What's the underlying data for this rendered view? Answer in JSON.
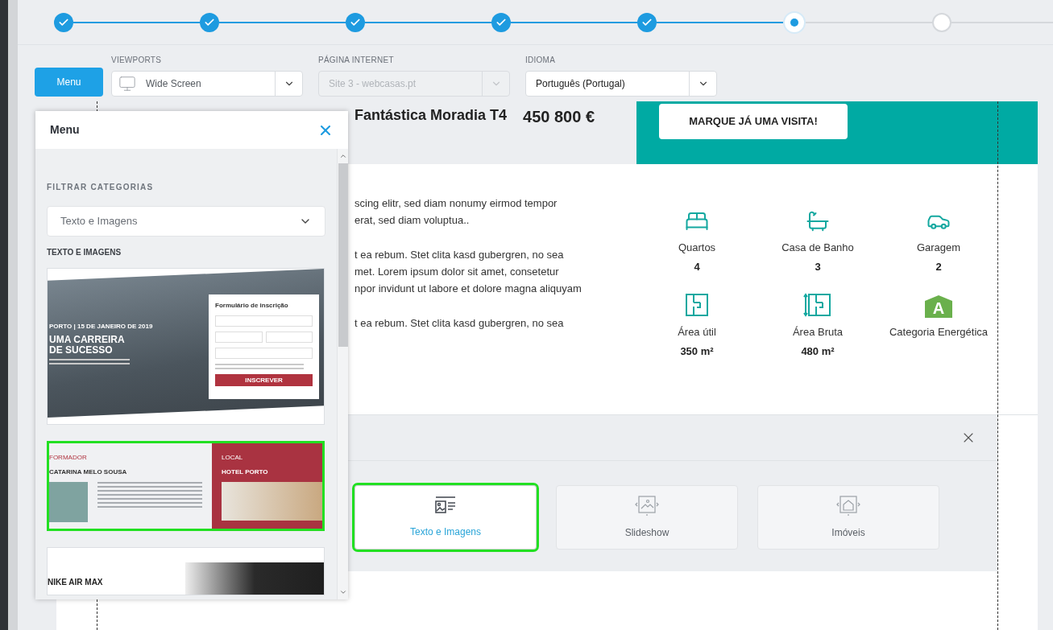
{
  "stepper": [
    {
      "done": true,
      "current": false
    },
    {
      "done": true,
      "current": false
    },
    {
      "done": true,
      "current": false
    },
    {
      "done": true,
      "current": false
    },
    {
      "done": true,
      "current": false
    },
    {
      "done": false,
      "current": true
    },
    {
      "done": false,
      "current": false
    }
  ],
  "toolbar": {
    "menu_button": "Menu",
    "fields": [
      {
        "label": "VIEWPORTS",
        "value": "Wide Screen",
        "kind": "device",
        "disabled": false
      },
      {
        "label": "PÁGINA INTERNET",
        "value": "Site 3 - webcasas.pt",
        "kind": "plain",
        "disabled": true
      },
      {
        "label": "IDIOMA",
        "value": "Português (Portugal)",
        "kind": "plain",
        "disabled": false
      }
    ]
  },
  "page": {
    "title": "Fantástica Moradia T4",
    "price": "450 800 €",
    "cta": "MARQUE JÁ UMA VISITA!",
    "paragraphs": [
      [
        "scing elitr, sed diam nonumy eirmod tempor",
        "erat, sed diam voluptua.."
      ],
      [
        "t ea rebum. Stet clita kasd gubergren, no sea",
        "met. Lorem ipsum dolor sit amet, consetetur",
        "npor invidunt ut labore et dolore magna aliquyam"
      ],
      [
        "t ea rebum. Stet clita kasd gubergren, no sea"
      ]
    ],
    "features": [
      {
        "kind": "bed",
        "label": "Quartos",
        "value": "4"
      },
      {
        "kind": "bath",
        "label": "Casa de Banho",
        "value": "3"
      },
      {
        "kind": "car",
        "label": "Garagem",
        "value": "2"
      },
      {
        "kind": "area",
        "label": "Área útil",
        "value": "350 m²"
      },
      {
        "kind": "gross",
        "label": "Área Bruta",
        "value": "480 m²"
      },
      {
        "kind": "energy",
        "label": "Categoria Energética",
        "grade": "A"
      }
    ]
  },
  "block_picker": {
    "types": [
      {
        "kind": "text",
        "label": "Texto e Imagens",
        "selected": true,
        "highlighted": true
      },
      {
        "kind": "slides",
        "label": "Slideshow",
        "selected": false,
        "highlighted": false
      },
      {
        "kind": "home",
        "label": "Imóveis",
        "selected": false,
        "highlighted": false
      }
    ]
  },
  "menu_panel": {
    "title": "Menu",
    "filter_label": "FILTRAR CATEGORIAS",
    "filter_value": "Texto e Imagens",
    "section": "TEXTO E IMAGENS",
    "templates": [
      {
        "kind": "event",
        "highlighted": false,
        "form_title": "Formulário de inscrição",
        "date": "PORTO | 15 DE JANEIRO DE 2019",
        "headline": "UMA CARREIRA DE SUCESSO",
        "button": "INSCREVER"
      },
      {
        "kind": "speaker",
        "highlighted": true,
        "role": "FORMADOR",
        "name": "CATARINA MELO SOUSA",
        "place_label": "LOCAL",
        "place": "HOTEL PORTO"
      },
      {
        "kind": "product",
        "highlighted": false,
        "headline": "NIKE AIR MAX"
      }
    ]
  }
}
